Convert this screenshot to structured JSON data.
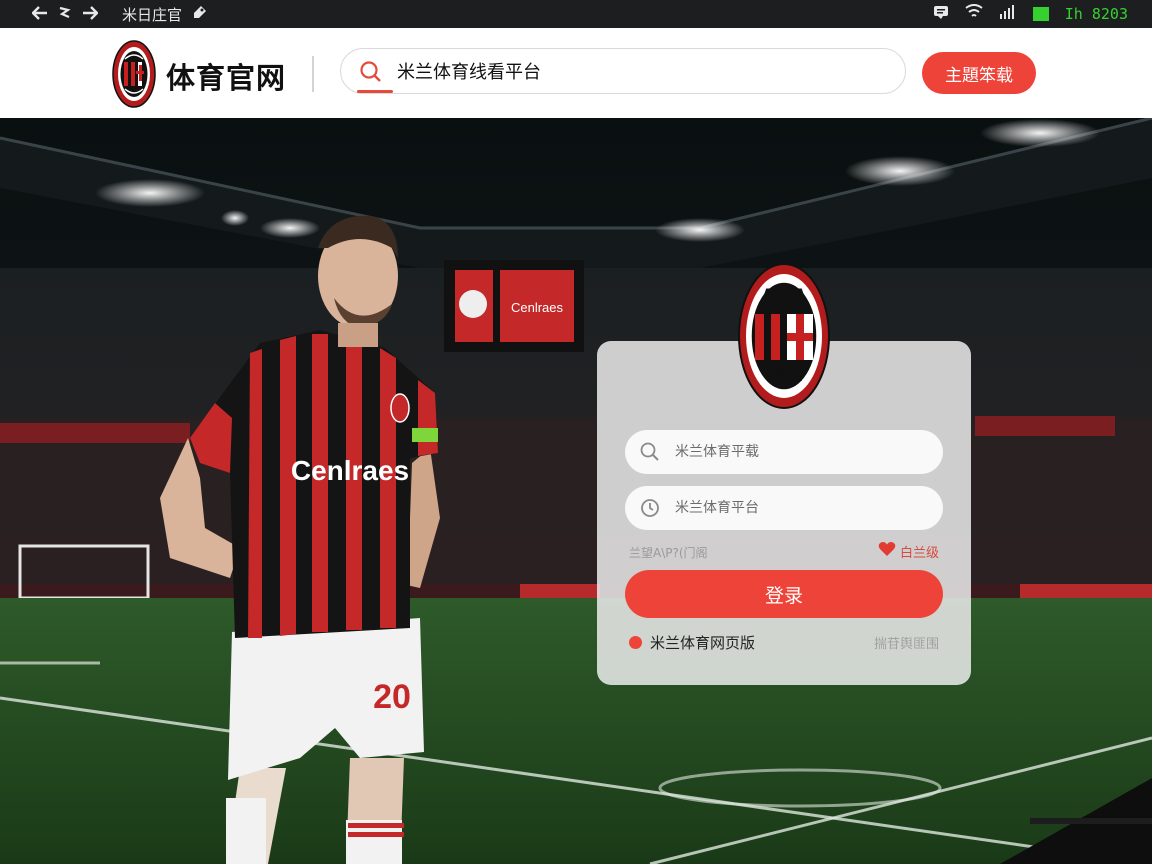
{
  "status_bar": {
    "back_icon": "arrow-left-icon",
    "flag_icon": "flag-icon",
    "forward_icon": "arrow-right-icon",
    "title": "米日庄官",
    "tag_icon": "tag-icon",
    "message_icon": "message-icon",
    "wifi_icon": "wifi-icon",
    "signal_icon": "signal-icon",
    "battery_color": "#35d22f",
    "time": "Ih 8203"
  },
  "header": {
    "site_name": "体育官网",
    "logo_icon": "ac-milan-crest-icon",
    "search": {
      "value": "米兰体育线看平台",
      "icon": "search-icon"
    },
    "download_button": "主題笨载"
  },
  "hero": {
    "jersey_text": "Cenlraes",
    "jersey_number": "20",
    "board_text": "Cenlraes",
    "crest_top": "ACA",
    "crest_bottom": "9ßIA"
  },
  "login_card": {
    "username_placeholder": "米兰体育平载",
    "password_placeholder": "米兰体育平台",
    "agreement_text": "兰望A\\P?(门阁",
    "forgot_text": "白兰级",
    "login_button": "登录",
    "web_link": "米兰体育网页版",
    "help_link": "揣苷舆匪围"
  },
  "colors": {
    "accent": "#ee4338",
    "status_green": "#35d22f"
  }
}
